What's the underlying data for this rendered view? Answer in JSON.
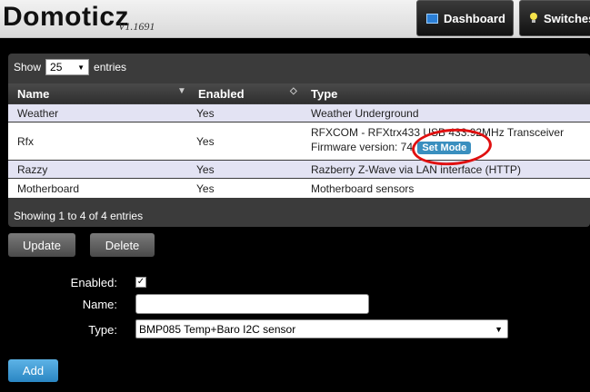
{
  "header": {
    "logo": "Domoticz",
    "version": "V1.1691",
    "nav": [
      {
        "label": "Dashboard",
        "icon": "dashboard-icon"
      },
      {
        "label": "Switches",
        "icon": "lightbulb-icon"
      }
    ]
  },
  "table": {
    "show_label": "Show",
    "entries_label": "entries",
    "page_size": "25",
    "columns": [
      "Name",
      "Enabled",
      "Type"
    ],
    "rows": [
      {
        "name": "Weather",
        "enabled": "Yes",
        "type": "Weather Underground",
        "type2": ""
      },
      {
        "name": "Rfx",
        "enabled": "Yes",
        "type": "RFXCOM - RFXtrx433 USB 433.92MHz Transceiver",
        "type2": "Firmware version: 74"
      },
      {
        "name": "Razzy",
        "enabled": "Yes",
        "type": "Razberry Z-Wave via LAN interface (HTTP)",
        "type2": ""
      },
      {
        "name": "Motherboard",
        "enabled": "Yes",
        "type": "Motherboard sensors",
        "type2": ""
      }
    ],
    "set_mode_label": "Set Mode",
    "info": "Showing 1 to 4 of 4 entries"
  },
  "actions": {
    "update_label": "Update",
    "delete_label": "Delete",
    "add_label": "Add"
  },
  "form": {
    "enabled_label": "Enabled:",
    "enabled_checked": true,
    "name_label": "Name:",
    "name_value": "",
    "type_label": "Type:",
    "type_value": "BMP085 Temp+Baro I2C sensor"
  },
  "colors": {
    "row_odd": "#e3e3f3",
    "set_mode": "#3a8fbf",
    "highlight_circle": "#e01010",
    "add_button": "#2a86c3"
  }
}
